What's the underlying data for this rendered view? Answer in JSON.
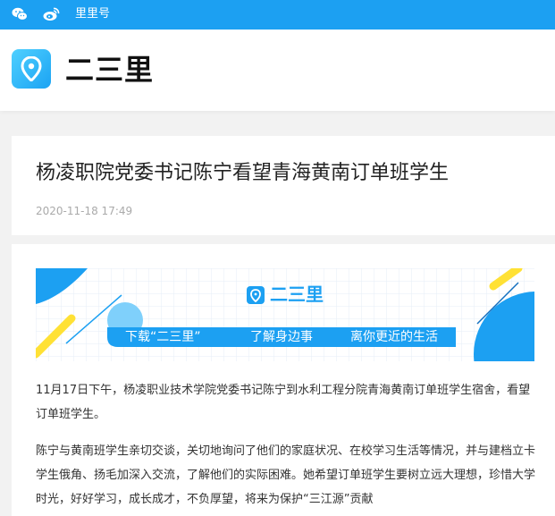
{
  "topbar": {
    "wechat_icon": "wechat-icon",
    "weibo_icon": "weibo-icon",
    "link_label": "里里号",
    "color": "#1ca0f2"
  },
  "header": {
    "logo_icon": "location-pin-icon",
    "brand": "二三里"
  },
  "article": {
    "title": "杨凌职院党委书记陈宁看望青海黄南订单班学生",
    "date": "2020-11-18 17:49",
    "banner": {
      "brand": "二三里",
      "tagline_1": "下载“二三里”",
      "tagline_2": "了解身边事",
      "tagline_3": "离你更近的生活"
    },
    "paragraphs": [
      "11月17日下午，杨凌职业技术学院党委书记陈宁到水利工程分院青海黄南订单班学生宿舍，看望订单班学生。",
      "陈宁与黄南班学生亲切交谈，关切地询问了他们的家庭状况、在校学习生活等情况，并与建档立卡学生俄角、扬毛加深入交流，了解他们的实际困难。她希望订单班学生要树立远大理想，珍惜大学时光，好好学习，成长成才，不负厚望，将来为保护“三江源”贡献"
    ]
  }
}
